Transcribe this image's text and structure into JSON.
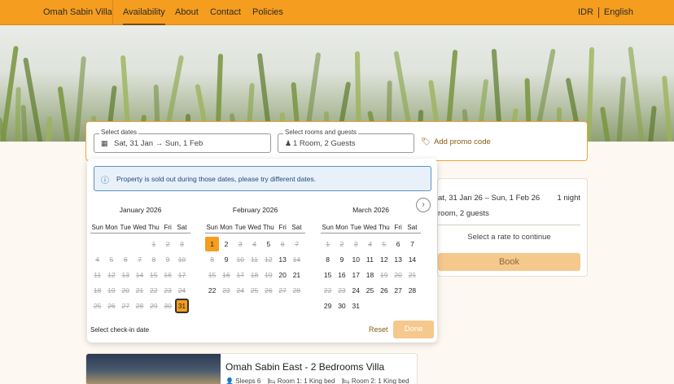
{
  "nav": {
    "brand": "Omah Sabin Villa",
    "items": [
      "Availability",
      "About",
      "Contact",
      "Policies"
    ],
    "currency": "IDR",
    "language": "English"
  },
  "search": {
    "dates_legend": "Select dates",
    "dates_value": "Sat, 31 Jan → Sun, 1 Feb",
    "rooms_legend": "Select rooms and guests",
    "rooms_value": "1 Room, 2 Guests",
    "promo": "Add promo code"
  },
  "calendar": {
    "alert": "Property is sold out during those dates, please try different dates.",
    "weekdays": [
      "Sun",
      "Mon",
      "Tue",
      "Wed",
      "Thu",
      "Fri",
      "Sat"
    ],
    "months": [
      {
        "title": "January 2026",
        "rows": [
          [
            "",
            "",
            "",
            "",
            "1",
            "2",
            "3"
          ],
          [
            "4",
            "5",
            "6",
            "7",
            "8",
            "9",
            "10"
          ],
          [
            "11",
            "12",
            "13",
            "14",
            "15",
            "16",
            "17"
          ],
          [
            "18",
            "19",
            "20",
            "21",
            "22",
            "23",
            "24"
          ],
          [
            "25",
            "26",
            "27",
            "28",
            "29",
            "30",
            "31"
          ]
        ]
      },
      {
        "title": "February 2026",
        "rows": [
          [
            "1",
            "2",
            "3",
            "4",
            "5",
            "6",
            "7"
          ],
          [
            "8",
            "9",
            "10",
            "11",
            "12",
            "13",
            "14"
          ],
          [
            "15",
            "16",
            "17",
            "18",
            "19",
            "20",
            "21"
          ],
          [
            "22",
            "23",
            "24",
            "25",
            "26",
            "27",
            "28"
          ]
        ]
      },
      {
        "title": "March 2026",
        "rows": [
          [
            "1",
            "2",
            "3",
            "4",
            "5",
            "6",
            "7"
          ],
          [
            "8",
            "9",
            "10",
            "11",
            "12",
            "13",
            "14"
          ],
          [
            "15",
            "16",
            "17",
            "18",
            "19",
            "20",
            "21"
          ],
          [
            "22",
            "23",
            "24",
            "25",
            "26",
            "27",
            "28"
          ],
          [
            "29",
            "30",
            "31",
            "",
            "",
            "",
            ""
          ]
        ]
      }
    ],
    "disabled": {
      "0": [
        "1",
        "2",
        "3",
        "4",
        "5",
        "6",
        "7",
        "8",
        "9",
        "10",
        "11",
        "12",
        "13",
        "14",
        "15",
        "16",
        "17",
        "18",
        "19",
        "20",
        "21",
        "22",
        "23",
        "24",
        "25",
        "26",
        "27",
        "28",
        "29",
        "30"
      ],
      "1": [
        "3",
        "4",
        "6",
        "7",
        "8",
        "10",
        "11",
        "12",
        "14",
        "15",
        "16",
        "17",
        "18",
        "19",
        "23",
        "24",
        "25",
        "26",
        "27",
        "28"
      ],
      "2": [
        "1",
        "2",
        "3",
        "4",
        "5",
        "19",
        "20",
        "21",
        "22",
        "23"
      ]
    },
    "selected_start": {
      "month": 1,
      "day": "1"
    },
    "selected_end": {
      "month": 0,
      "day": "31"
    },
    "footer_label": "Select check-in date",
    "reset_label": "Reset",
    "done_label": "Done"
  },
  "summary": {
    "dates": "at, 31 Jan 26 – Sun, 1 Feb 26",
    "nights": "1 night",
    "rooms": "room, 2 guests",
    "rate_prompt": "Select a rate to continue",
    "book_label": "Book"
  },
  "villa": {
    "title": "Omah Sabin East - 2 Bedrooms Villa",
    "sleeps": "Sleeps 6",
    "room1": "Room 1: 1 King bed",
    "room2": "Room 2: 1 King bed"
  },
  "colors": {
    "brand": "#f59d1e",
    "accent_text": "#8a5a12",
    "alert_border": "#5c8fc5"
  }
}
